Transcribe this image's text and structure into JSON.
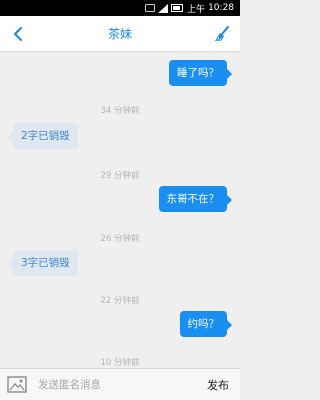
{
  "status_bar": {
    "meridiem": "上午",
    "time": "10:28",
    "icons": [
      "notification-icon",
      "signal-icon",
      "battery-icon"
    ]
  },
  "header": {
    "title": "茶妹",
    "back_icon": "chevron-left-icon",
    "clean_icon": "broom-icon",
    "accent_color": "#1b87e3"
  },
  "messages": [
    {
      "kind": "sent",
      "text": "睡了吗？"
    },
    {
      "kind": "timestamp",
      "text": "34 分钟前"
    },
    {
      "kind": "received",
      "text": "2字已销毁"
    },
    {
      "kind": "timestamp",
      "text": "29 分钟前"
    },
    {
      "kind": "sent",
      "text": "东哥不在？"
    },
    {
      "kind": "timestamp",
      "text": "26 分钟前"
    },
    {
      "kind": "received",
      "text": "3字已销毁"
    },
    {
      "kind": "timestamp",
      "text": "22 分钟前"
    },
    {
      "kind": "sent",
      "text": "约吗？"
    },
    {
      "kind": "timestamp",
      "text": "10 分钟前"
    }
  ],
  "colors": {
    "sent_bubble": "#1b8ef2",
    "received_bubble": "#dfe7ef",
    "received_text": "#3e87d6",
    "background": "#efefef"
  },
  "input_bar": {
    "image_icon": "image-icon",
    "placeholder": "发送匿名消息",
    "value": "",
    "send_label": "发布"
  }
}
